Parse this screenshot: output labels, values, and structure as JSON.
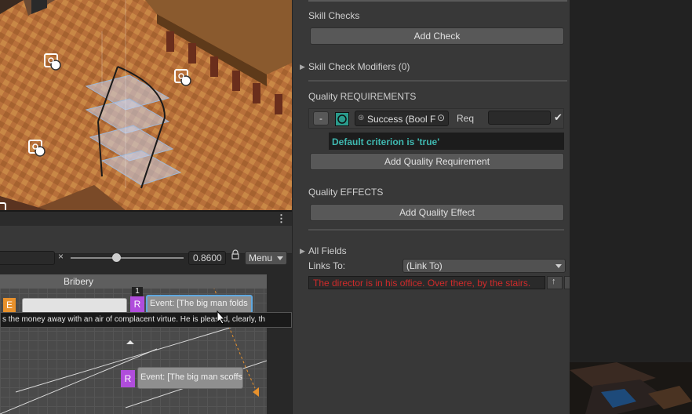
{
  "graph": {
    "zoom_value": "0.8600",
    "menu_label": "Menu",
    "node_title": "Bribery",
    "badge_count": "1",
    "node_e": "E",
    "node_r1": "R",
    "event1": "Event: [The big man folds",
    "tooltip": "s the money away with an air of complacent virtue. He is pleased, clearly, th",
    "node_r2": "R",
    "event2": "Event: [The big man scoffs"
  },
  "inspector": {
    "skill_checks_heading": "Skill Checks",
    "add_check_label": "Add Check",
    "skill_check_modifiers_label": "Skill Check Modifiers (0)",
    "quality_requirements_heading": "Quality REQUIREMENTS",
    "remove_label": "-",
    "quality_field_value": "Success (Bool F",
    "req_label": "Req",
    "default_criterion_text": "Default criterion is 'true'",
    "add_quality_requirement_label": "Add Quality Requirement",
    "quality_effects_heading": "Quality EFFECTS",
    "add_quality_effect_label": "Add Quality Effect",
    "all_fields_label": "All Fields",
    "links_to_label": "Links To:",
    "links_to_value": "(Link To)",
    "text_field_value": "The director is in his office. Over there, by the stairs."
  },
  "colors": {
    "accent_purple": "#b04ddc",
    "accent_orange": "#e8912c",
    "criterion_teal": "#3fb8b0",
    "error_red": "#d02a2a"
  }
}
